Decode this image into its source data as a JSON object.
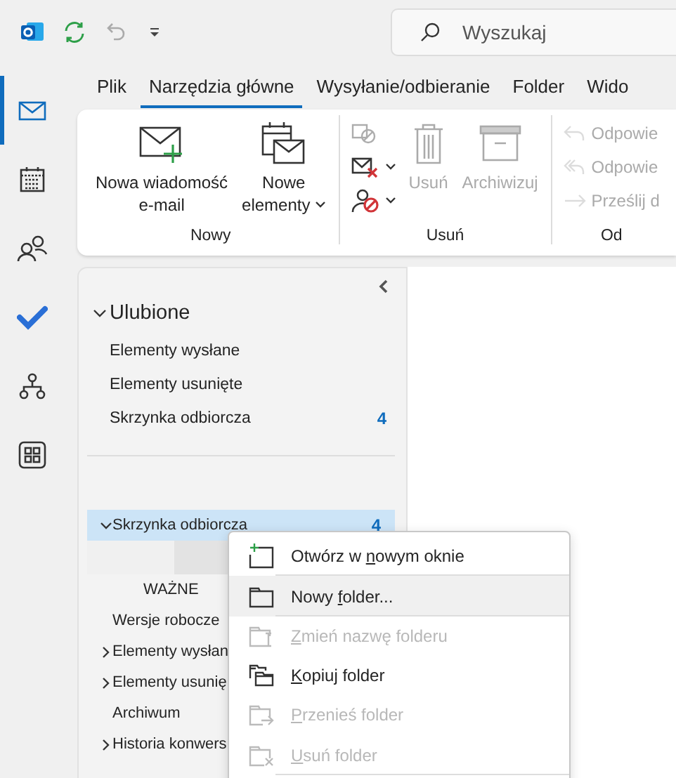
{
  "search": {
    "placeholder": "Wyszukaj"
  },
  "nav_rail": [
    {
      "kind": "mail",
      "selected": true
    },
    {
      "kind": "calendar",
      "selected": false
    },
    {
      "kind": "people",
      "selected": false
    },
    {
      "kind": "todo",
      "selected": false
    },
    {
      "kind": "org",
      "selected": false
    },
    {
      "kind": "apps",
      "selected": false
    }
  ],
  "tabs": [
    {
      "label": "Plik",
      "selected": false
    },
    {
      "label": "Narzędzia główne",
      "selected": true
    },
    {
      "label": "Wysyłanie/odbieranie",
      "selected": false
    },
    {
      "label": "Folder",
      "selected": false
    },
    {
      "label": "Wido",
      "selected": false
    }
  ],
  "ribbon": [
    {
      "label": "Nowy",
      "large": [
        {
          "kind": "new-mail",
          "lines": [
            "Nowa wiadomość",
            "e-mail"
          ],
          "dropdown": false,
          "disabled": false
        },
        {
          "kind": "new-items",
          "lines": [
            "Nowe",
            "elementy"
          ],
          "dropdown": true,
          "disabled": false
        }
      ]
    },
    {
      "label": "Usuń",
      "small": [
        {
          "kind": "ignore",
          "dropdown": false,
          "disabled": true
        },
        {
          "kind": "cleanup",
          "dropdown": true,
          "disabled": false
        },
        {
          "kind": "junk",
          "dropdown": true,
          "disabled": false
        }
      ],
      "large": [
        {
          "kind": "delete",
          "lines": [
            "Usuń"
          ],
          "dropdown": false,
          "disabled": true
        },
        {
          "kind": "archive",
          "lines": [
            "Archiwizuj"
          ],
          "dropdown": false,
          "disabled": true
        }
      ]
    },
    {
      "label": "Od",
      "small": [
        {
          "kind": "reply",
          "label": "Odpowie",
          "disabled": true
        },
        {
          "kind": "reply-all",
          "label": "Odpowie",
          "disabled": true
        },
        {
          "kind": "forward",
          "label": "Prześlij d",
          "disabled": true
        }
      ]
    }
  ],
  "favorites": {
    "label": "Ulubione",
    "expanded": true,
    "items": [
      {
        "name": "Elementy wysłane"
      },
      {
        "name": "Elementy usunięte"
      },
      {
        "name": "Skrzynka odbiorcza",
        "count": "4"
      }
    ]
  },
  "folders": [
    {
      "kind": "folder",
      "name": "Skrzynka odbiorcza",
      "count": "4",
      "selected": true,
      "expanded": true,
      "children": [
        {
          "kind": "blank",
          "selected": false
        },
        {
          "kind": "folder",
          "name": "WAŻNE",
          "selected": false
        }
      ]
    },
    {
      "kind": "folder",
      "name": "Wersje robocze",
      "selected": false
    },
    {
      "kind": "folder",
      "name": "Elementy wysłan",
      "selected": false,
      "expanded": false
    },
    {
      "kind": "folder",
      "name": "Elementy usunię",
      "selected": false,
      "expanded": false
    },
    {
      "kind": "folder",
      "name": "Archiwum",
      "selected": false
    },
    {
      "kind": "folder",
      "name": "Historia konwers",
      "selected": false,
      "expanded": false
    }
  ],
  "context_menu": [
    {
      "kind": "open-window",
      "before": "Otwórz w ",
      "key": "n",
      "after": "owym oknie",
      "disabled": false,
      "selected": false,
      "separator_after": true
    },
    {
      "kind": "new-folder",
      "before": "Nowy ",
      "key": "f",
      "after": "older...",
      "disabled": false,
      "selected": true,
      "separator_after": true
    },
    {
      "kind": "rename",
      "key": "Z",
      "after": "mień nazwę folderu",
      "disabled": true,
      "selected": false,
      "separator_after": false
    },
    {
      "kind": "copy",
      "key": "K",
      "after": "opiuj folder",
      "disabled": false,
      "selected": false,
      "separator_after": false
    },
    {
      "kind": "move",
      "key": "P",
      "after": "rzenieś folder",
      "disabled": true,
      "selected": false,
      "separator_after": false
    },
    {
      "kind": "delete",
      "key": "U",
      "after": "suń folder",
      "disabled": true,
      "selected": false,
      "separator_after": true
    }
  ]
}
